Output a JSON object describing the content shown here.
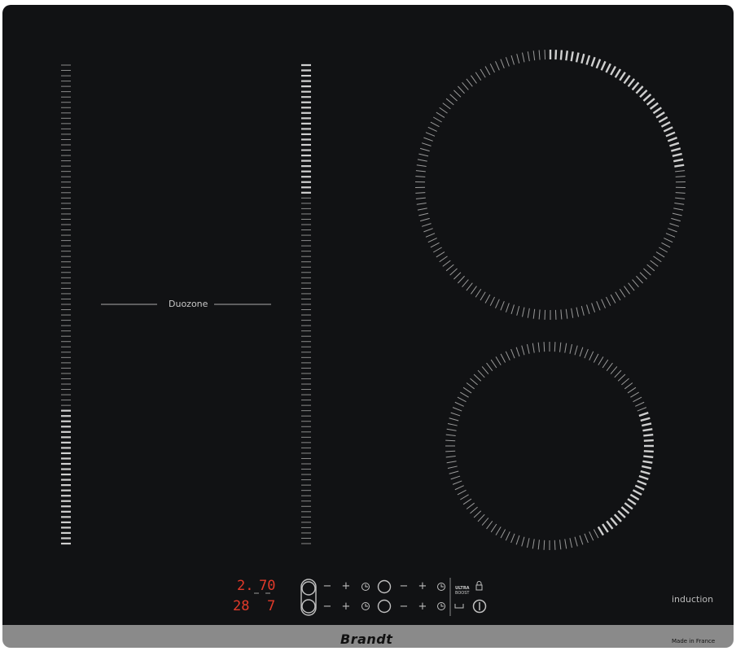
{
  "zones": {
    "duozone_label": "Duozone",
    "left_slider_level": 0.28,
    "right_slider_level": 0.27,
    "rear_right_zone_arc_deg": [
      0,
      82
    ],
    "front_right_zone_arc_deg": [
      70,
      152
    ]
  },
  "display": {
    "top_left": "2.",
    "top_right": "70",
    "bottom_left": "28",
    "bottom_right": "7"
  },
  "controls": {
    "minus": "−",
    "plus": "+",
    "ultra": "ULTRA",
    "boost": "BOOST"
  },
  "labels": {
    "induction": "induction",
    "brand": "Brandt",
    "made_in": "Made in France"
  },
  "colors": {
    "glass": "#111214",
    "frame": "#8a8a8a",
    "display": "#e23a2a",
    "ticks": "#b8b8b8"
  }
}
